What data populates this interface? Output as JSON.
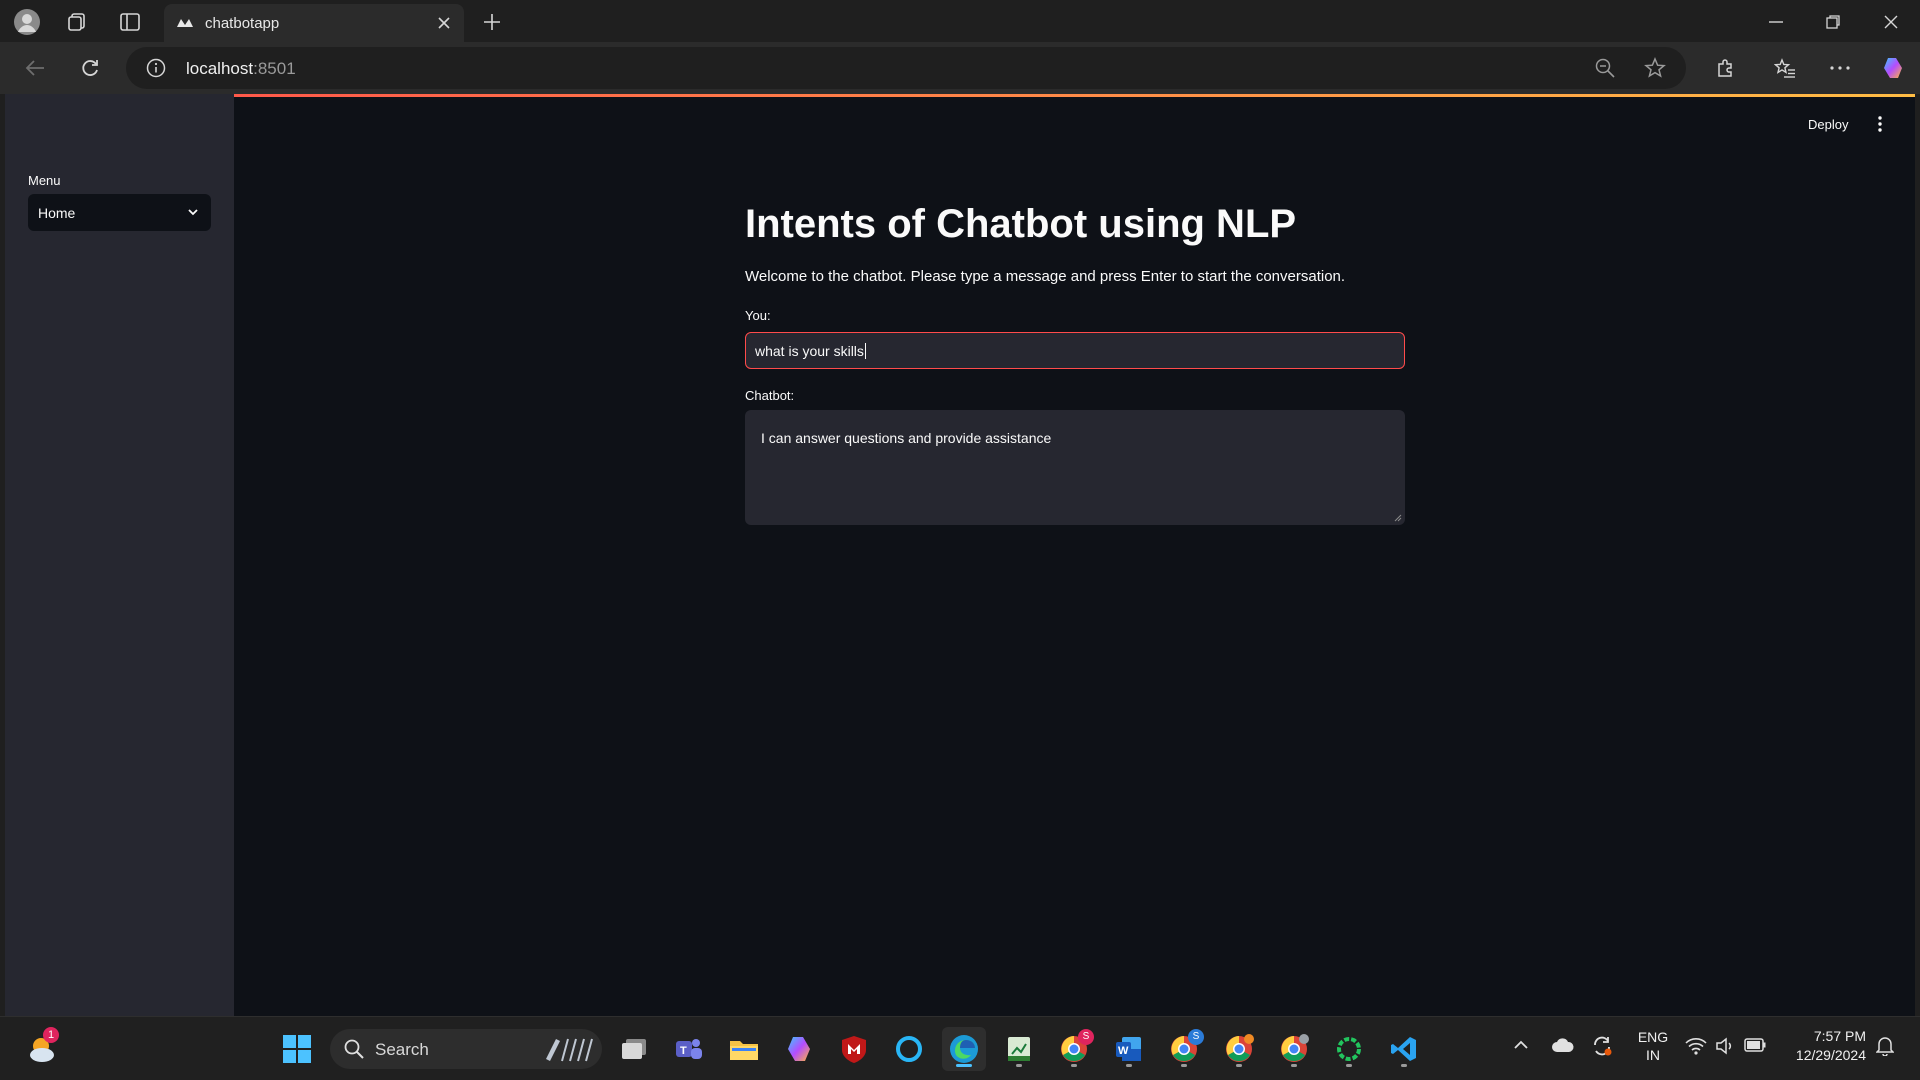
{
  "browser": {
    "tab_title": "chatbotapp",
    "url_host": "localhost",
    "url_port": ":8501"
  },
  "app": {
    "deploy_label": "Deploy",
    "sidebar": {
      "menu_label": "Menu",
      "menu_selected": "Home"
    },
    "main": {
      "title": "Intents of Chatbot using NLP",
      "welcome": "Welcome to the chatbot. Please type a message and press Enter to start the conversation.",
      "you_label": "You:",
      "you_value": "what is your skills",
      "chatbot_label": "Chatbot:",
      "chatbot_value": "I can answer questions and provide assistance"
    }
  },
  "taskbar": {
    "search_label": "Search",
    "weather_badge": "1",
    "lang_line1": "ENG",
    "lang_line2": "IN",
    "time": "7:57 PM",
    "date": "12/29/2024",
    "badge_s": "S"
  },
  "colors": {
    "page_bg": "#0e1117",
    "sidebar_bg": "#262730",
    "accent": "#ff4b4b",
    "edge_blue": "#4cc2ff"
  }
}
